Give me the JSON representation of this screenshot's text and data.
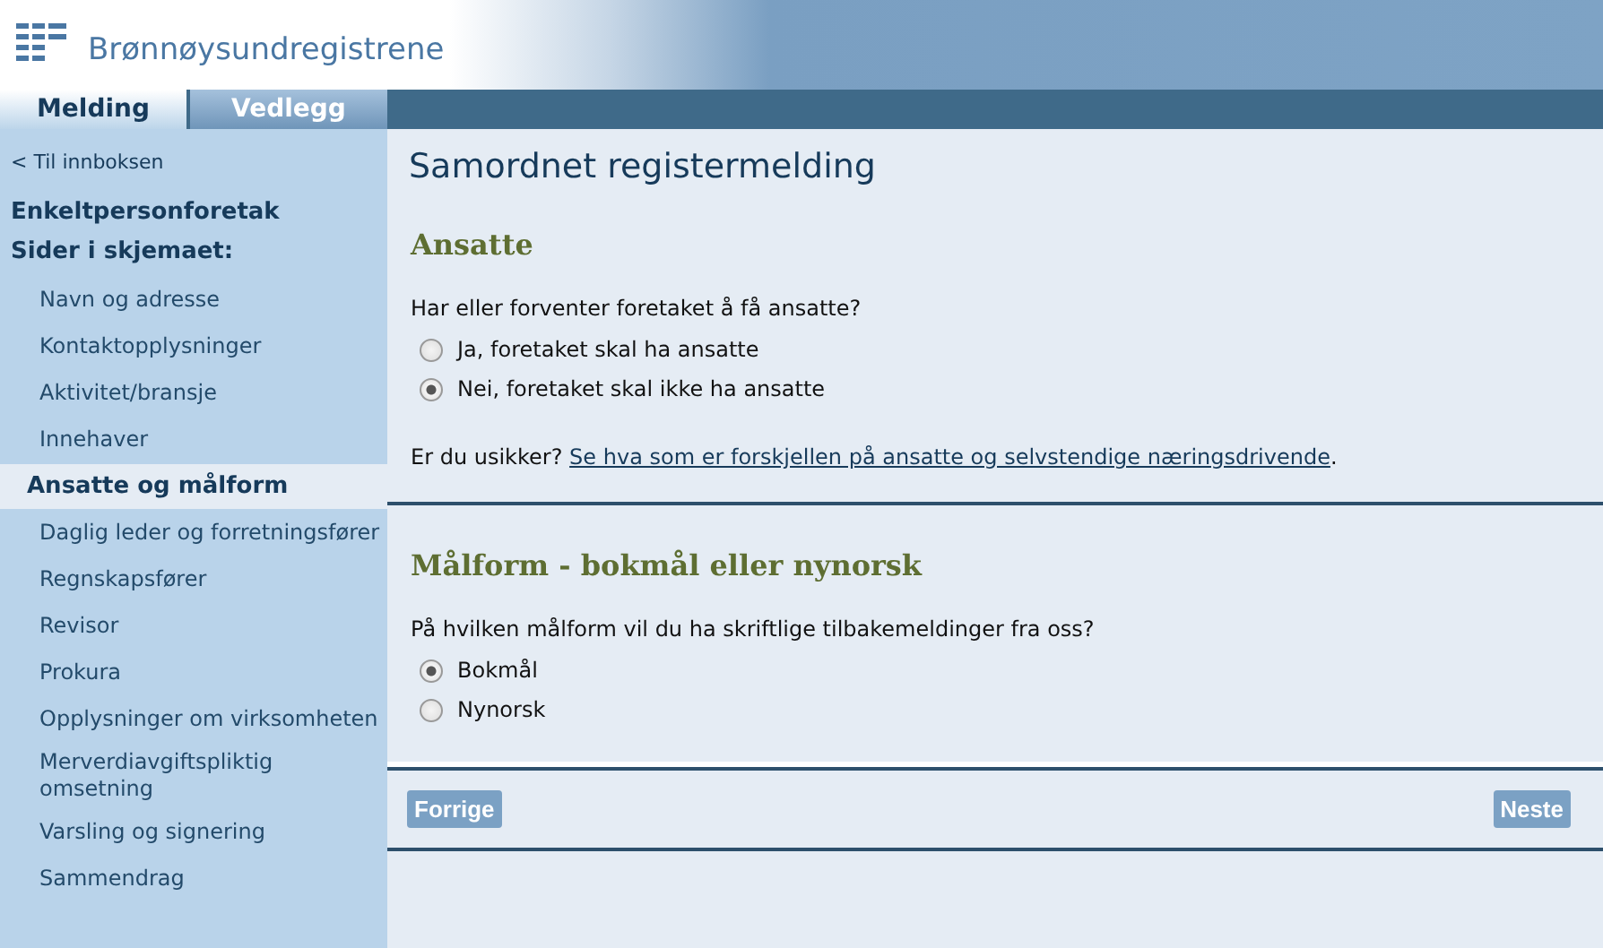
{
  "header": {
    "logo_text": "Brønnøysundregistrene"
  },
  "tabs": [
    {
      "label": "Melding",
      "selected": true
    },
    {
      "label": "Vedlegg",
      "selected": false
    }
  ],
  "sidebar": {
    "back_link": "< Til innboksen",
    "form_type": "Enkeltpersonforetak",
    "pages_heading": "Sider i skjemaet:",
    "items": [
      {
        "label": "Navn og adresse",
        "selected": false
      },
      {
        "label": "Kontaktopplysninger",
        "selected": false
      },
      {
        "label": "Aktivitet/bransje",
        "selected": false
      },
      {
        "label": "Innehaver",
        "selected": false
      },
      {
        "label": "Ansatte og målform",
        "selected": true
      },
      {
        "label": "Daglig leder og forretningsfører",
        "selected": false
      },
      {
        "label": "Regnskapsfører",
        "selected": false
      },
      {
        "label": "Revisor",
        "selected": false
      },
      {
        "label": "Prokura",
        "selected": false
      },
      {
        "label": "Opplysninger om virksomheten",
        "selected": false
      },
      {
        "label": "Merverdiavgiftspliktig omsetning",
        "selected": false
      },
      {
        "label": "Varsling og signering",
        "selected": false
      },
      {
        "label": "Sammendrag",
        "selected": false
      }
    ]
  },
  "page_title": "Samordnet registermelding",
  "sections": [
    {
      "heading": "Ansatte",
      "question": "Har eller forventer foretaket å få ansatte?",
      "options": [
        {
          "label": "Ja, foretaket skal ha ansatte",
          "selected": false
        },
        {
          "label": "Nei, foretaket skal ikke ha ansatte",
          "selected": true
        }
      ],
      "help": {
        "prefix": "Er du usikker?",
        "link": "Se hva som er forskjellen på ansatte og selvstendige næringsdrivende",
        "suffix": "."
      }
    },
    {
      "heading": "Målform - bokmål eller nynorsk",
      "question": "På hvilken målform vil du ha skriftlige tilbakemeldinger fra oss?",
      "options": [
        {
          "label": "Bokmål",
          "selected": true
        },
        {
          "label": "Nynorsk",
          "selected": false
        }
      ]
    }
  ],
  "buttons": {
    "previous": "Forrige",
    "next": "Neste"
  }
}
